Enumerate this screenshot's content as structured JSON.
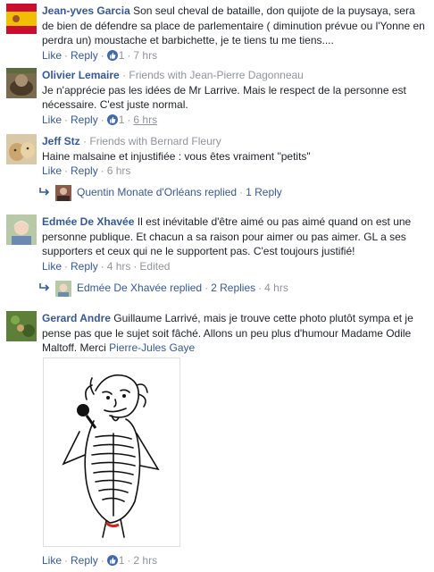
{
  "comments": [
    {
      "name": "Jean-yves Garcia",
      "text": "Son seul cheval de bataille, don quijote de la puysaya, sera de bien de défendre sa place de parlementaire ( diminution prévue ou l'Yonne en perdra un) moustache et barbichette, je te tiens tu me tiens....",
      "like": "Like",
      "reply": "Reply",
      "reactions": "1",
      "time": "7 hrs"
    },
    {
      "name": "Olivier Lemaire",
      "friends": "Friends with Jean-Pierre Dagonneau",
      "text": "Je n'apprécie pas les idées de Mr Larrive. Mais le respect de la personne est nécessaire. C'est juste normal.",
      "like": "Like",
      "reply": "Reply",
      "reactions": "1",
      "time": "6 hrs"
    },
    {
      "name": "Jeff Stz",
      "friends": "Friends with Bernard Fleury",
      "text": "Haine malsaine et injustifiée : vous êtes vraiment \"petits\"",
      "like": "Like",
      "reply": "Reply",
      "time": "6 hrs",
      "replies_summary": {
        "author": "Quentin Monate d'Orléans",
        "verb": "replied",
        "count": "1 Reply"
      }
    },
    {
      "name": "Edmée De Xhavée",
      "text": "Il est inévitable d'être aimé ou pas aimé quand on est une personne publique. Et chacun a sa raison pour aimer ou pas aimer. GL a ses supporters et ceux qui ne le supportent pas. C'est toujours justifié!",
      "like": "Like",
      "reply": "Reply",
      "time": "4 hrs",
      "edited": "Edited",
      "replies_summary": {
        "author": "Edmée De Xhavée",
        "verb": "replied",
        "count": "2 Replies",
        "time": "4 hrs"
      }
    },
    {
      "name": "Gerard Andre",
      "text": "Guillaume Larrivé, mais je trouve cette photo plutôt sympa et je pense pas que le sujet soit fâché. Allons un peu plus d'humour Madame Odile Maltoff. Merci",
      "mention": "Pierre-Jules Gaye",
      "like": "Like",
      "reply": "Reply",
      "reactions": "1",
      "time": "2 hrs"
    }
  ],
  "icons": {
    "like": "like-thumb-icon",
    "reply_arrow": "reply-arrow-icon"
  },
  "colors": {
    "link": "#365899",
    "muted": "#90949c",
    "like_badge": "#4267b2"
  }
}
